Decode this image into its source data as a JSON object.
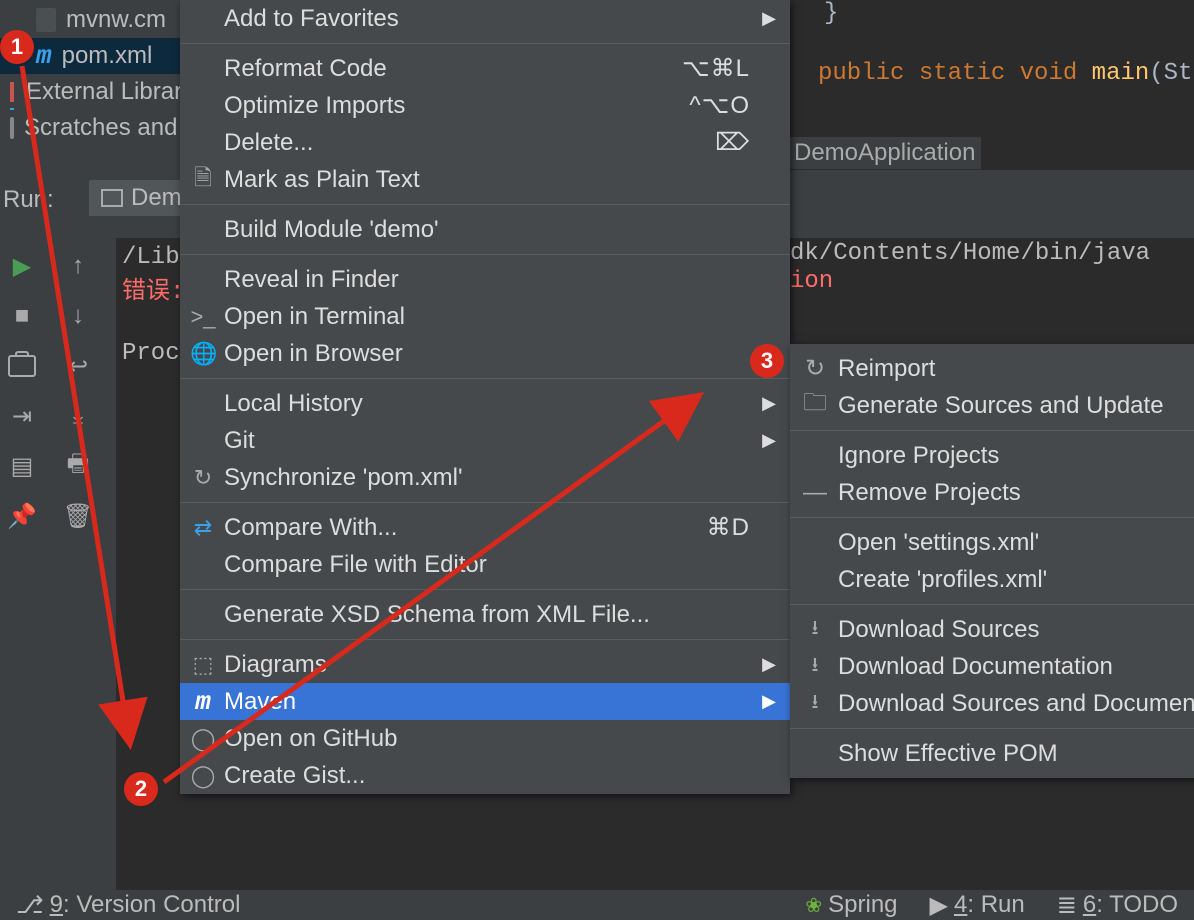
{
  "left_tree": {
    "mvnw": "mvnw.cm",
    "pom": "pom.xml",
    "external": "External Libraries",
    "scratches": "Scratches and Consoles"
  },
  "run_panel": {
    "label": "Run:",
    "tab": "Demo"
  },
  "console": {
    "path": "/Library …",
    "error": "错误:",
    "error_suffix": "ion",
    "proc": "Process"
  },
  "editor": {
    "brace": "}",
    "kw_public": "public",
    "kw_static": "static",
    "kw_void": "void",
    "fn": "main",
    "args": "(Str",
    "breadcrumb": "DemoApplication",
    "java_path": "dk/Contents/Home/bin/java  ..."
  },
  "menu": {
    "add_fav": "Add to Favorites",
    "reformat": "Reformat Code",
    "reformat_sc": "⌥⌘L",
    "optimize": "Optimize Imports",
    "optimize_sc": "^⌥O",
    "delete": "Delete...",
    "delete_sc": "⌦",
    "mark_plain": "Mark as Plain Text",
    "build_mod": "Build Module 'demo'",
    "reveal": "Reveal in Finder",
    "open_term": "Open in Terminal",
    "open_browser": "Open in Browser",
    "local_hist": "Local History",
    "git": "Git",
    "sync": "Synchronize 'pom.xml'",
    "compare_with": "Compare With...",
    "compare_with_sc": "⌘D",
    "compare_ed": "Compare File with Editor",
    "xsd": "Generate XSD Schema from XML File...",
    "diagrams": "Diagrams",
    "maven": "Maven",
    "open_gh": "Open on GitHub",
    "create_gist": "Create Gist..."
  },
  "submenu": {
    "reimport": "Reimport",
    "gen_src": "Generate Sources and Update",
    "ignore": "Ignore Projects",
    "remove": "Remove Projects",
    "open_settings": "Open 'settings.xml'",
    "create_profiles": "Create 'profiles.xml'",
    "dl_src": "Download Sources",
    "dl_doc": "Download Documentation",
    "dl_both": "Download Sources and Documentation",
    "show_pom": "Show Effective POM"
  },
  "status": {
    "vc": "9: Version Control",
    "spring": "Spring",
    "run": "4: Run",
    "todo": "6: TODO"
  },
  "annotations": {
    "a1": "1",
    "a2": "2",
    "a3": "3"
  }
}
